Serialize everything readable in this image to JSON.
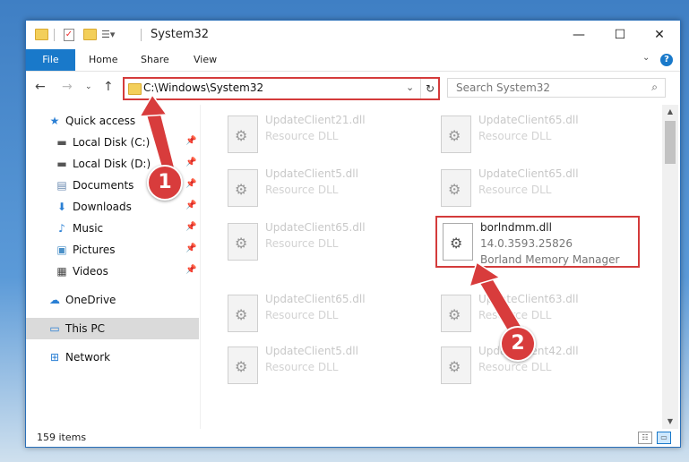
{
  "window": {
    "title": "System32",
    "controls": {
      "minimize": "—",
      "maximize": "☐",
      "close": "✕"
    }
  },
  "ribbon": {
    "tabs": [
      "File",
      "Home",
      "Share",
      "View"
    ],
    "help": "?"
  },
  "address": {
    "path": "C:\\Windows\\System32",
    "search_placeholder": "Search System32"
  },
  "sidebar": {
    "items": [
      {
        "label": "Quick access",
        "icon": "star-icon",
        "pinned": false
      },
      {
        "label": "Local Disk (C:)",
        "icon": "drive-icon",
        "pinned": true
      },
      {
        "label": "Local Disk (D:)",
        "icon": "drive-icon",
        "pinned": true
      },
      {
        "label": "Documents",
        "icon": "documents-icon",
        "pinned": true
      },
      {
        "label": "Downloads",
        "icon": "download-icon",
        "pinned": true
      },
      {
        "label": "Music",
        "icon": "music-icon",
        "pinned": true
      },
      {
        "label": "Pictures",
        "icon": "pictures-icon",
        "pinned": true
      },
      {
        "label": "Videos",
        "icon": "videos-icon",
        "pinned": true
      },
      {
        "label": "OneDrive",
        "icon": "cloud-icon",
        "pinned": false
      },
      {
        "label": "This PC",
        "icon": "computer-icon",
        "pinned": false,
        "selected": true
      },
      {
        "label": "Network",
        "icon": "network-icon",
        "pinned": false
      }
    ]
  },
  "files": [
    {
      "name": "UpdateClient21.dll",
      "desc": "Resource DLL"
    },
    {
      "name": "UpdateClient65.dll",
      "desc": "Resource DLL"
    },
    {
      "name": "UpdateClient5.dll",
      "desc": "Resource DLL"
    },
    {
      "name": "UpdateClient65.dll",
      "desc": "Resource DLL"
    },
    {
      "name": "UpdateClient65.dll",
      "desc": "Resource DLL"
    },
    {
      "name": "borlndmm.dll",
      "version": "14.0.3593.25826",
      "manufacturer": "Borland Memory Manager",
      "highlighted": true
    },
    {
      "name": "UpdateClient65.dll",
      "desc": "Resource DLL"
    },
    {
      "name": "UpdateClient63.dll",
      "desc": "Resource DLL"
    },
    {
      "name": "UpdateClient5.dll",
      "desc": "Resource DLL"
    },
    {
      "name": "UpdateClient42.dll",
      "desc": "Resource DLL"
    }
  ],
  "status": {
    "item_count": "159 items"
  },
  "markers": {
    "step1": "1",
    "step2": "2"
  },
  "colors": {
    "accent": "#1979ca",
    "highlight": "#d43b3b"
  }
}
